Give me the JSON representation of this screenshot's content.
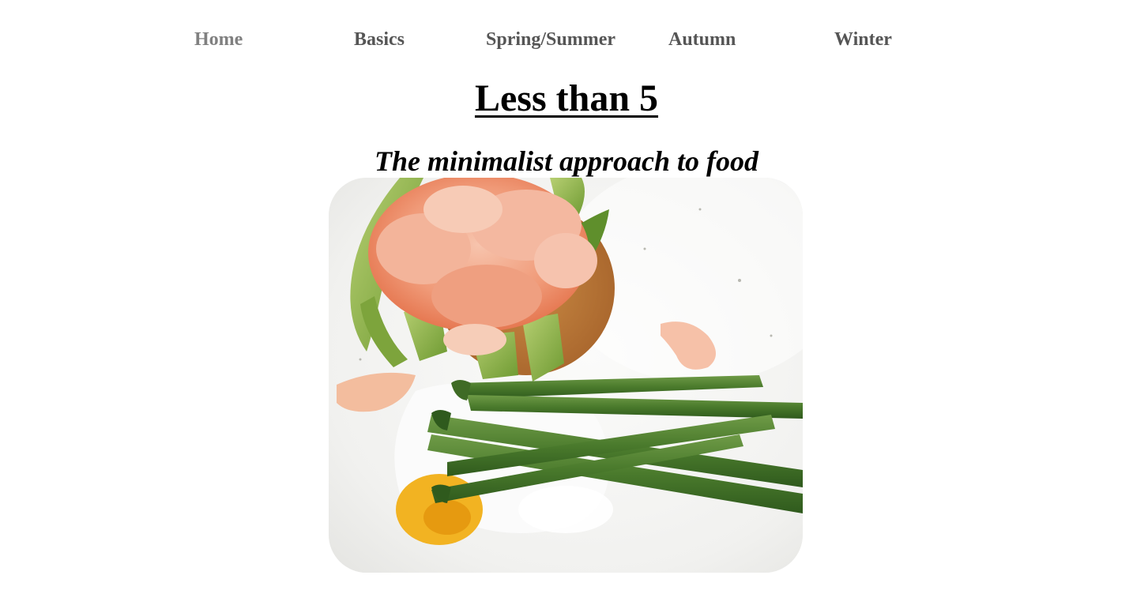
{
  "nav": {
    "items": [
      {
        "label": "Home"
      },
      {
        "label": "Basics"
      },
      {
        "label": "Spring/Summer"
      },
      {
        "label": "Autumn"
      },
      {
        "label": "Winter"
      }
    ]
  },
  "header": {
    "title": "Less than 5",
    "subtitle": "The minimalist approach to food"
  },
  "colors": {
    "nav_text": "#555555",
    "nav_active": "#808080",
    "text": "#000000",
    "background": "#ffffff"
  },
  "hero_image": {
    "subject": "food-photo"
  }
}
